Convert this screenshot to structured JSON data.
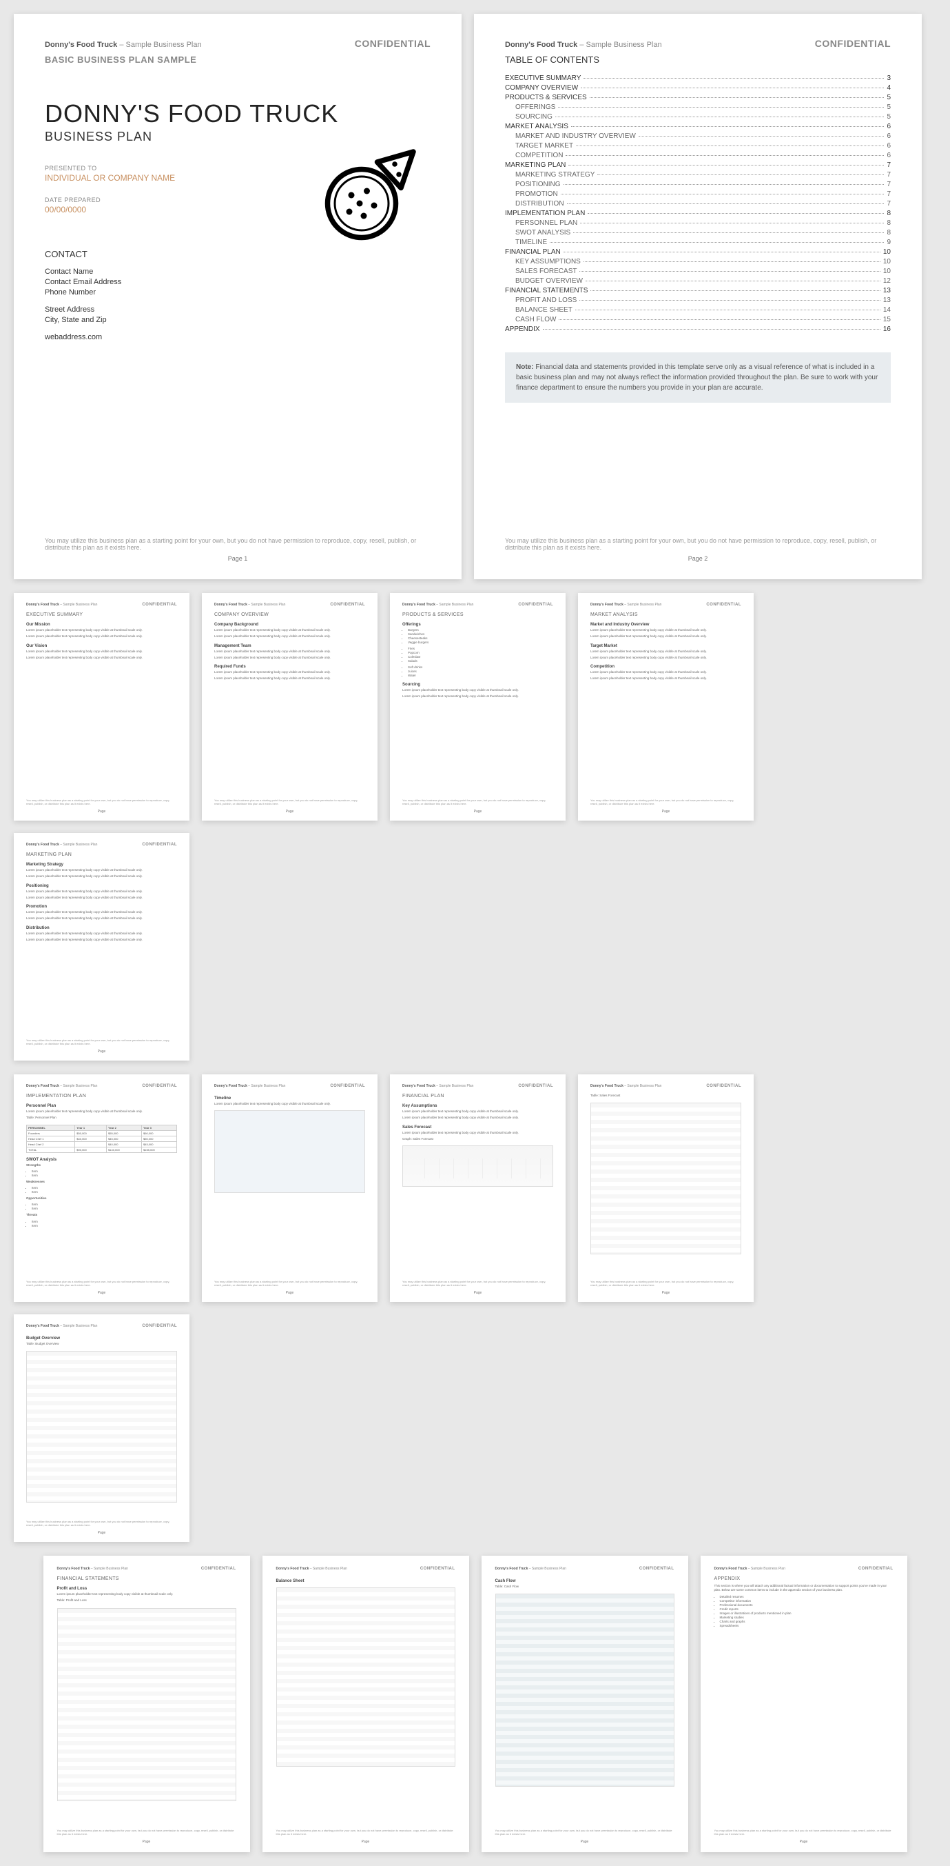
{
  "hdr": {
    "brand": "Donny's Food Truck",
    "suffix": " – Sample Business Plan",
    "conf": "CONFIDENTIAL"
  },
  "p1": {
    "subtitle": "BASIC BUSINESS PLAN SAMPLE",
    "title": "DONNY'S FOOD TRUCK",
    "bp": "BUSINESS PLAN",
    "presented_label": "PRESENTED TO",
    "presented": "INDIVIDUAL OR COMPANY NAME",
    "date_label": "DATE PREPARED",
    "date": "00/00/0000",
    "contact_h": "CONTACT",
    "c1": "Contact Name",
    "c2": "Contact Email Address",
    "c3": "Phone Number",
    "c4": "Street Address",
    "c5": "City, State and Zip",
    "c6": "webaddress.com"
  },
  "footer": "You may utilize this business plan as a starting point for your own, but you do not have permission to reproduce, copy, resell, publish, or distribute this plan as it exists here.",
  "pgnum": {
    "p1": "Page 1",
    "p2": "Page 2"
  },
  "toc": {
    "h": "TABLE OF CONTENTS",
    "items": [
      {
        "t": "EXECUTIVE SUMMARY",
        "p": "3"
      },
      {
        "t": "COMPANY OVERVIEW",
        "p": "4"
      },
      {
        "t": "PRODUCTS & SERVICES",
        "p": "5"
      },
      {
        "t": "OFFERINGS",
        "p": "5",
        "sub": 1
      },
      {
        "t": "SOURCING",
        "p": "5",
        "sub": 1
      },
      {
        "t": "MARKET ANALYSIS",
        "p": "6"
      },
      {
        "t": "MARKET AND INDUSTRY OVERVIEW",
        "p": "6",
        "sub": 1
      },
      {
        "t": "TARGET MARKET",
        "p": "6",
        "sub": 1
      },
      {
        "t": "COMPETITION",
        "p": "6",
        "sub": 1
      },
      {
        "t": "MARKETING PLAN",
        "p": "7"
      },
      {
        "t": "MARKETING STRATEGY",
        "p": "7",
        "sub": 1
      },
      {
        "t": "POSITIONING",
        "p": "7",
        "sub": 1
      },
      {
        "t": "PROMOTION",
        "p": "7",
        "sub": 1
      },
      {
        "t": "DISTRIBUTION",
        "p": "7",
        "sub": 1
      },
      {
        "t": "IMPLEMENTATION PLAN",
        "p": "8"
      },
      {
        "t": "PERSONNEL PLAN",
        "p": "8",
        "sub": 1
      },
      {
        "t": "SWOT ANALYSIS",
        "p": "8",
        "sub": 1
      },
      {
        "t": "TIMELINE",
        "p": "9",
        "sub": 1
      },
      {
        "t": "FINANCIAL PLAN",
        "p": "10"
      },
      {
        "t": "KEY ASSUMPTIONS",
        "p": "10",
        "sub": 1
      },
      {
        "t": "SALES FORECAST",
        "p": "10",
        "sub": 1
      },
      {
        "t": "BUDGET OVERVIEW",
        "p": "12",
        "sub": 1
      },
      {
        "t": "FINANCIAL STATEMENTS",
        "p": "13"
      },
      {
        "t": "PROFIT AND LOSS",
        "p": "13",
        "sub": 1
      },
      {
        "t": "BALANCE SHEET",
        "p": "14",
        "sub": 1
      },
      {
        "t": "CASH FLOW",
        "p": "15",
        "sub": 1
      },
      {
        "t": "APPENDIX",
        "p": "16"
      }
    ]
  },
  "note": {
    "label": "Note:",
    "body": " Financial data and statements provided in this template serve only as a visual reference of what is included in a basic business plan and may not always reflect the information provided throughout the plan. Be sure to work with your finance department to ensure the numbers you provide in your plan are accurate."
  },
  "thumbs": [
    {
      "h": "EXECUTIVE SUMMARY",
      "subs": [
        "Our Mission",
        "Our Vision"
      ]
    },
    {
      "h": "COMPANY OVERVIEW",
      "subs": [
        "Company Background",
        "Management Team",
        "Required Funds"
      ]
    },
    {
      "h": "PRODUCTS & SERVICES",
      "subs": [
        "Offerings",
        "Sourcing"
      ]
    },
    {
      "h": "MARKET ANALYSIS",
      "subs": [
        "Market and Industry Overview",
        "Target Market",
        "Competition"
      ]
    },
    {
      "h": "MARKETING PLAN",
      "subs": [
        "Marketing Strategy",
        "Positioning",
        "Promotion",
        "Distribution"
      ]
    },
    {
      "h": "IMPLEMENTATION PLAN",
      "subs": [
        "Personnel Plan",
        "SWOT Analysis"
      ]
    },
    {
      "h": "",
      "subs": [
        "Timeline"
      ]
    },
    {
      "h": "FINANCIAL PLAN",
      "subs": [
        "Key Assumptions",
        "Sales Forecast"
      ]
    },
    {
      "h": "",
      "subs": []
    },
    {
      "h": "",
      "subs": [
        "Budget Overview"
      ]
    },
    {
      "h": "FINANCIAL STATEMENTS",
      "subs": [
        "Profit and Loss"
      ]
    },
    {
      "h": "",
      "subs": [
        "Balance Sheet"
      ]
    },
    {
      "h": "",
      "subs": [
        "Cash Flow"
      ]
    },
    {
      "h": "APPENDIX",
      "subs": []
    }
  ],
  "swot": {
    "s": "Strengths",
    "w": "Weaknesses",
    "o": "Opportunities",
    "t": "Threats"
  },
  "personnel": {
    "label": "Table: Personnel Plan",
    "cols": [
      "PERSONNEL",
      "Year 1",
      "Year 2",
      "Year 3"
    ],
    "rows": [
      [
        "Founders",
        "$50,000",
        "$55,000",
        "$60,000"
      ],
      [
        "Head Chef 1",
        "$40,000",
        "$45,000",
        "$50,000"
      ],
      [
        "Head Chef 2",
        "",
        "$40,000",
        "$45,000"
      ],
      [
        "TOTAL",
        "$90,000",
        "$140,000",
        "$155,000"
      ]
    ]
  },
  "appendix": {
    "intro": "This section is where you will attach any additional factual information or documentation to support points you've made in your plan. Below are some common items to include in the appendix section of your business plan.",
    "items": [
      "Detailed resumes",
      "Competitor information",
      "Professional documents",
      "Credit reports",
      "Images or illustrations of products mentioned in plan",
      "Marketing studies",
      "Charts and graphs",
      "Spreadsheets"
    ]
  }
}
